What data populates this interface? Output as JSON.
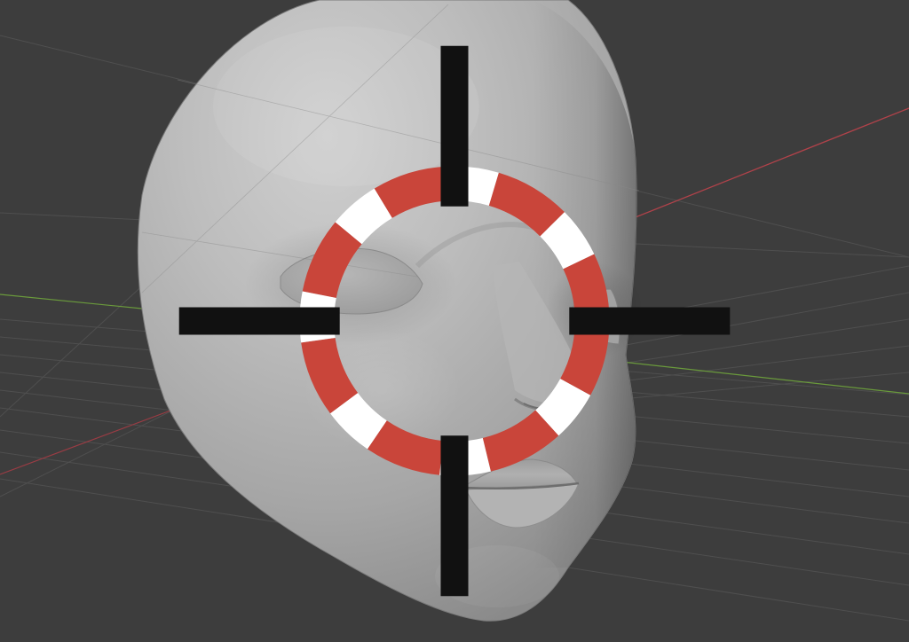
{
  "app": "3D viewport",
  "viewport": {
    "background_color": "#3d3d3d",
    "grid_color": "#4f4f4f",
    "x_axis_color": "#b1424a",
    "y_axis_color": "#6a9a3c",
    "object": "head-mesh",
    "shading": "solid",
    "mesh_color": "#b4b4b4"
  },
  "icons": {
    "cursor": "3d-cursor-icon"
  }
}
